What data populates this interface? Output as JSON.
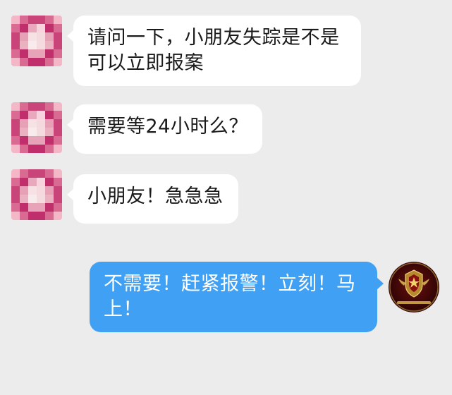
{
  "messages": [
    {
      "side": "incoming",
      "text": "请问一下，小朋友失踪是不是可以立即报案"
    },
    {
      "side": "incoming",
      "text": "需要等24小时么？"
    },
    {
      "side": "incoming",
      "text": "小朋友！急急急"
    },
    {
      "side": "outgoing",
      "text": "不需要！赶紧报警！立刻！马上！"
    }
  ],
  "colors": {
    "background": "#ececec",
    "incoming_bubble": "#ffffff",
    "outgoing_bubble": "#3fa0f4",
    "text_dark": "#1a1a1a",
    "text_light": "#ffffff"
  },
  "avatars": {
    "incoming": "pixelated-user-avatar",
    "outgoing": "police-badge-avatar"
  }
}
